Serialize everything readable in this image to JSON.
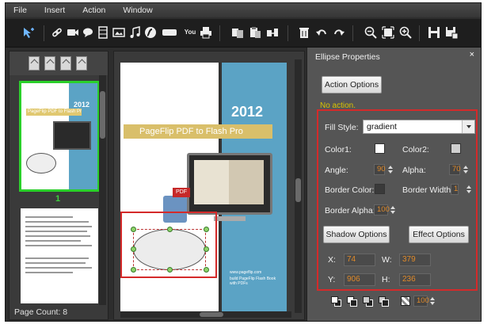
{
  "menu": {
    "items": [
      "File",
      "Insert",
      "Action",
      "Window"
    ]
  },
  "toolbar": {
    "icons": [
      "select-cursor-icon",
      "link-icon",
      "video-icon",
      "speech-bubble-icon",
      "film-icon",
      "image-icon",
      "music-icon",
      "flash-icon",
      "button-icon",
      "youtube-icon",
      "print-icon",
      "copy-icon",
      "paste-icon",
      "duplicate-icon",
      "delete-icon",
      "undo-icon",
      "redo-icon",
      "zoom-out-icon",
      "fit-icon",
      "zoom-in-icon",
      "save-icon",
      "save-as-icon"
    ],
    "youtube_text": "You"
  },
  "thumbnails": {
    "page_number": "1",
    "thumb_year": "2012",
    "thumb_band": "PageFlip PDF to Flash Pro",
    "page_count": "Page Count: 8"
  },
  "canvas": {
    "year": "2012",
    "band_title": "PageFlip PDF to Flash Pro",
    "pdf_tag": "PDF",
    "small_text_1": "www.pageflip.com",
    "small_text_2": "build PageFlip Flash Book with PDFs"
  },
  "properties": {
    "title": "Ellipse Properties",
    "close": "×",
    "action_options_label": "Action Options",
    "no_action": "No action.",
    "fill_style_label": "Fill Style:",
    "fill_style_value": "gradient",
    "color1_label": "Color1:",
    "color2_label": "Color2:",
    "color1": "#ffffff",
    "color2": "#d0d0d0",
    "angle_label": "Angle:",
    "angle_value": "90",
    "alpha_label": "Alpha:",
    "alpha_value": "70",
    "border_color_label": "Border Color:",
    "border_color": "#3a3a3a",
    "border_width_label": "Border Width:",
    "border_width_value": "1",
    "border_alpha_label": "Border Alpha:",
    "border_alpha_value": "100",
    "shadow_options_label": "Shadow Options",
    "effect_options_label": "Effect Options",
    "x_label": "X:",
    "x_value": "74",
    "w_label": "W:",
    "w_value": "379",
    "y_label": "Y:",
    "y_value": "906",
    "h_label": "H:",
    "h_value": "236",
    "opacity_value": "100"
  }
}
